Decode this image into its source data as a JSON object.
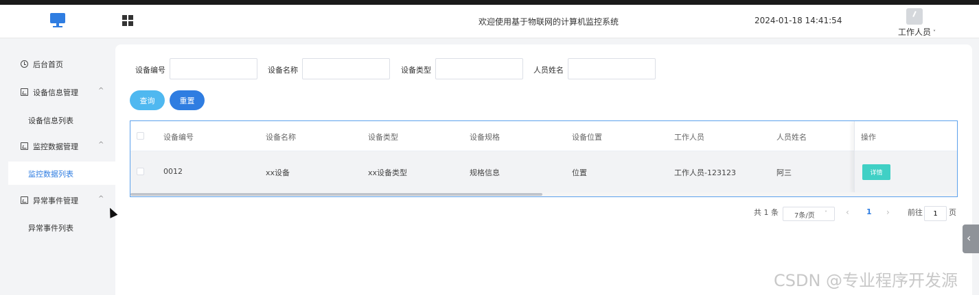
{
  "header": {
    "logo_icon": "monitor-icon",
    "menu_icon": "grid-icon",
    "title": "欢迎使用基于物联网的计算机监控系统",
    "datetime": "2024-01-18 14:41:54",
    "user_label": "工作人员",
    "user_caret": "˅"
  },
  "sidebar": {
    "items": [
      {
        "label": "后台首页",
        "icon": "clock-icon"
      },
      {
        "label": "设备信息管理",
        "icon": "chart-icon",
        "arrow": "^",
        "children": [
          {
            "label": "设备信息列表"
          }
        ]
      },
      {
        "label": "监控数据管理",
        "icon": "chart-icon",
        "arrow": "^",
        "children": [
          {
            "label": "监控数据列表",
            "active": true
          }
        ]
      },
      {
        "label": "异常事件管理",
        "icon": "chart-icon",
        "arrow": "^",
        "children": [
          {
            "label": "异常事件列表"
          }
        ]
      }
    ]
  },
  "search": {
    "fields": [
      {
        "label": "设备编号",
        "value": ""
      },
      {
        "label": "设备名称",
        "value": ""
      },
      {
        "label": "设备类型",
        "value": ""
      },
      {
        "label": "人员姓名",
        "value": ""
      }
    ],
    "query_label": "查询",
    "reset_label": "重置"
  },
  "table": {
    "columns": [
      "设备编号",
      "设备名称",
      "设备类型",
      "设备规格",
      "设备位置",
      "工作人员",
      "人员姓名",
      "操作"
    ],
    "rows": [
      {
        "cells": [
          "0012",
          "xx设备",
          "xx设备类型",
          "规格信息",
          "位置",
          "工作人员-123123",
          "阿三"
        ],
        "action": "详情"
      }
    ]
  },
  "pagination": {
    "total": "共 1 条",
    "page_size": "7条/页",
    "prev": "‹",
    "current": "1",
    "next": "›",
    "goto_prefix": "前往",
    "goto_value": "1",
    "goto_suffix": "页"
  },
  "side_tab_icon": "‹",
  "watermark": "CSDN @专业程序开发源",
  "colors": {
    "accent": "#2f7de1",
    "query": "#4fb8f0",
    "detail": "#40d0c5"
  }
}
